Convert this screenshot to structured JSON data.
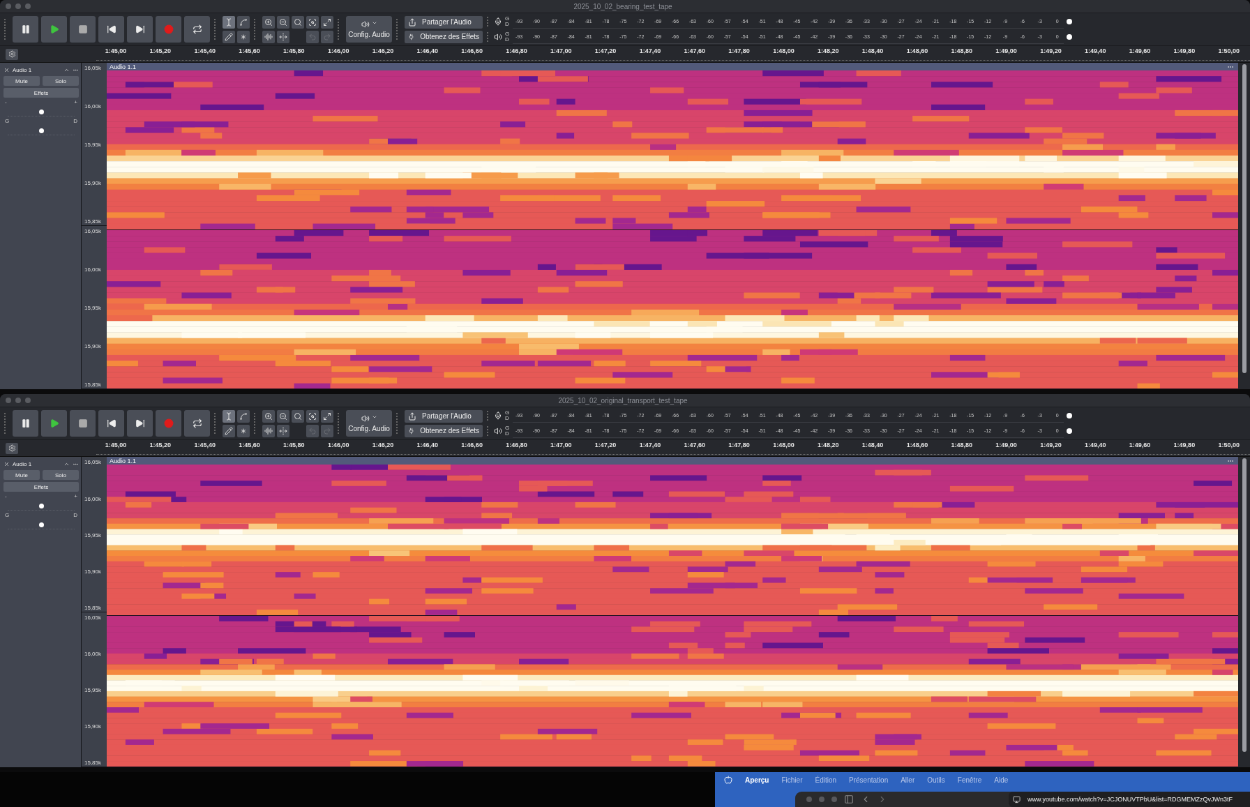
{
  "windows": [
    {
      "title": "2025_10_02_bearing_test_tape",
      "tools": [
        {
          "kind": "select",
          "selected": true
        },
        {
          "kind": "envelope",
          "selected": false
        },
        {
          "kind": "draw",
          "selected": false
        },
        {
          "kind": "multi",
          "selected": false
        }
      ],
      "config_audio": "Config. Audio",
      "share_button": "Partager l'Audio",
      "effects_button": "Obtenez des Effets",
      "meters": [
        {
          "kind": "record",
          "channels": [
            "G",
            "D"
          ],
          "scale": [
            "-93",
            "-90",
            "-87",
            "-84",
            "-81",
            "-78",
            "-75",
            "-72",
            "-69",
            "-66",
            "-63",
            "-60",
            "-57",
            "-54",
            "-51",
            "-48",
            "-45",
            "-42",
            "-39",
            "-36",
            "-33",
            "-30",
            "-27",
            "-24",
            "-21",
            "-18",
            "-15",
            "-12",
            "-9",
            "-6",
            "-3",
            "0"
          ]
        },
        {
          "kind": "playback",
          "channels": [
            "G",
            "D"
          ],
          "scale": [
            "-93",
            "-90",
            "-87",
            "-84",
            "-81",
            "-78",
            "-75",
            "-72",
            "-69",
            "-66",
            "-63",
            "-60",
            "-57",
            "-54",
            "-51",
            "-48",
            "-45",
            "-42",
            "-39",
            "-36",
            "-33",
            "-30",
            "-27",
            "-24",
            "-21",
            "-18",
            "-15",
            "-12",
            "-9",
            "-6",
            "-3",
            "0"
          ]
        }
      ],
      "timeline": [
        "1:45,00",
        "1:45,20",
        "1:45,40",
        "1:45,60",
        "1:45,80",
        "1:46,00",
        "1:46,20",
        "1:46,40",
        "1:46,60",
        "1:46,80",
        "1:47,00",
        "1:47,20",
        "1:47,40",
        "1:47,60",
        "1:47,80",
        "1:48,00",
        "1:48,20",
        "1:48,40",
        "1:48,60",
        "1:48,80",
        "1:49,00",
        "1:49,20",
        "1:49,40",
        "1:49,60",
        "1:49,80",
        "1:50,00"
      ],
      "track": {
        "name": "Audio 1",
        "mute": "Mute",
        "solo": "Solo",
        "effects": "Effets",
        "gain": {
          "min": "-",
          "max": "+",
          "level": 0.5
        },
        "pan": {
          "left": "G",
          "right": "D",
          "level": 0.5
        },
        "clip": "Audio 1.1",
        "channels": [
          {
            "axis": [
              "16,05k",
              "16,00k",
              "15,95k",
              "15,90k",
              "15,85k"
            ]
          },
          {
            "axis": [
              "16,05k",
              "16,00k",
              "15,95k",
              "15,90k",
              "15,85k"
            ]
          }
        ]
      }
    },
    {
      "title": "2025_10_02_original_transport_test_tape",
      "tools": [
        {
          "kind": "select",
          "selected": true
        },
        {
          "kind": "envelope",
          "selected": false
        },
        {
          "kind": "draw",
          "selected": false
        },
        {
          "kind": "multi",
          "selected": false
        }
      ],
      "config_audio": "Config. Audio",
      "share_button": "Partager l'Audio",
      "effects_button": "Obtenez des Effets",
      "meters": [
        {
          "kind": "record",
          "channels": [
            "G",
            "D"
          ],
          "scale": [
            "-93",
            "-90",
            "-87",
            "-84",
            "-81",
            "-78",
            "-75",
            "-72",
            "-69",
            "-66",
            "-63",
            "-60",
            "-57",
            "-54",
            "-51",
            "-48",
            "-45",
            "-42",
            "-39",
            "-36",
            "-33",
            "-30",
            "-27",
            "-24",
            "-21",
            "-18",
            "-15",
            "-12",
            "-9",
            "-6",
            "-3",
            "0"
          ]
        },
        {
          "kind": "playback",
          "channels": [
            "G",
            "D"
          ],
          "scale": [
            "-93",
            "-90",
            "-87",
            "-84",
            "-81",
            "-78",
            "-75",
            "-72",
            "-69",
            "-66",
            "-63",
            "-60",
            "-57",
            "-54",
            "-51",
            "-48",
            "-45",
            "-42",
            "-39",
            "-36",
            "-33",
            "-30",
            "-27",
            "-24",
            "-21",
            "-18",
            "-15",
            "-12",
            "-9",
            "-6",
            "-3",
            "0"
          ]
        }
      ],
      "timeline": [
        "1:45,00",
        "1:45,20",
        "1:45,40",
        "1:45,60",
        "1:45,80",
        "1:46,00",
        "1:46,20",
        "1:46,40",
        "1:46,60",
        "1:46,80",
        "1:47,00",
        "1:47,20",
        "1:47,40",
        "1:47,60",
        "1:47,80",
        "1:48,00",
        "1:48,20",
        "1:48,40",
        "1:48,60",
        "1:48,80",
        "1:49,00",
        "1:49,20",
        "1:49,40",
        "1:49,60",
        "1:49,80",
        "1:50,00"
      ],
      "track": {
        "name": "Audio 1",
        "mute": "Mute",
        "solo": "Solo",
        "effects": "Effets",
        "gain": {
          "min": "-",
          "max": "+",
          "level": 0.5
        },
        "pan": {
          "left": "G",
          "right": "D",
          "level": 0.5
        },
        "clip": "Audio 1.1",
        "channels": [
          {
            "axis": [
              "16,05k",
              "16,00k",
              "15,95k",
              "15,90k",
              "15,85k"
            ]
          },
          {
            "axis": [
              "16,05k",
              "16,00k",
              "15,95k",
              "15,90k",
              "15,85k"
            ]
          }
        ]
      }
    }
  ],
  "menubar": {
    "items": [
      "Aperçu",
      "Fichier",
      "Édition",
      "Présentation",
      "Aller",
      "Outils",
      "Fenêtre",
      "Aide"
    ]
  },
  "browser": {
    "url": "www.youtube.com/watch?v=JCJONUVTPbU&list=RDGMEMZzQvJWn3tF"
  }
}
